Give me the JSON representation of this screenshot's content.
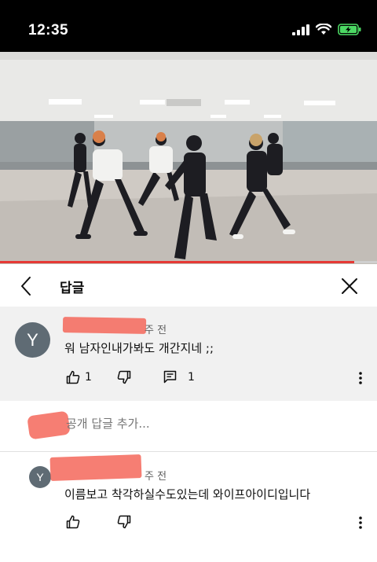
{
  "status": {
    "time": "12:35"
  },
  "header": {
    "title": "답글"
  },
  "video": {
    "progress_fraction": 0.94
  },
  "parent_comment": {
    "avatar_letter": "Y",
    "time_ago": "주 전",
    "text": "워 남자인내가봐도 개간지네 ;;",
    "likes": "1",
    "replies": "1"
  },
  "add_reply": {
    "placeholder": "공개 답글 추가..."
  },
  "reply": {
    "avatar_letter": "Y",
    "time_ago": "주 전",
    "text": "이름보고 착각하실수도있는데 와이프아이디입니다"
  },
  "colors": {
    "accent": "#e53935",
    "avatar": "#5f6b74",
    "redaction": "#f5675a"
  }
}
